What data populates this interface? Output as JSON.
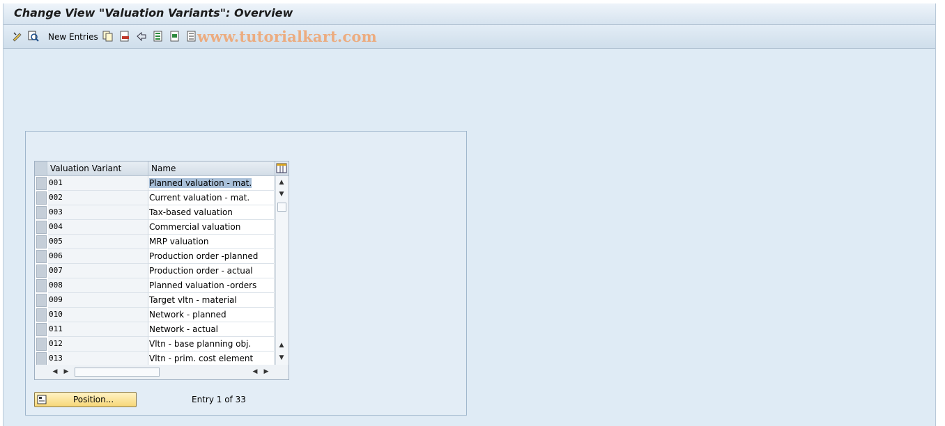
{
  "window": {
    "title": "Change View \"Valuation Variants\": Overview"
  },
  "toolbar": {
    "new_entries": "New Entries",
    "icons": [
      "display-change-icon",
      "details-icon",
      "copy-icon",
      "delete-icon",
      "undo-icon",
      "select-all-icon",
      "select-block-icon",
      "deselect-all-icon"
    ],
    "watermark": "www.tutorialkart.com"
  },
  "table": {
    "columns": [
      "Valuation Variant",
      "Name"
    ],
    "rows": [
      {
        "code": "001",
        "name": "Planned valuation - mat."
      },
      {
        "code": "002",
        "name": "Current valuation - mat."
      },
      {
        "code": "003",
        "name": "Tax-based valuation"
      },
      {
        "code": "004",
        "name": "Commercial valuation"
      },
      {
        "code": "005",
        "name": "MRP valuation"
      },
      {
        "code": "006",
        "name": "Production order -planned"
      },
      {
        "code": "007",
        "name": "Production order - actual"
      },
      {
        "code": "008",
        "name": "Planned valuation -orders"
      },
      {
        "code": "009",
        "name": "Target vltn - material"
      },
      {
        "code": "010",
        "name": "Network - planned"
      },
      {
        "code": "011",
        "name": "Network - actual"
      },
      {
        "code": "012",
        "name": "Vltn - base planning obj."
      },
      {
        "code": "013",
        "name": "Vltn - prim. cost element"
      }
    ]
  },
  "footer": {
    "position_button": "Position...",
    "entry_info": "Entry 1 of 33"
  },
  "colors": {
    "background": "#dfebf5",
    "selected_text": "#a9c0d9",
    "button": "#f7d777"
  }
}
